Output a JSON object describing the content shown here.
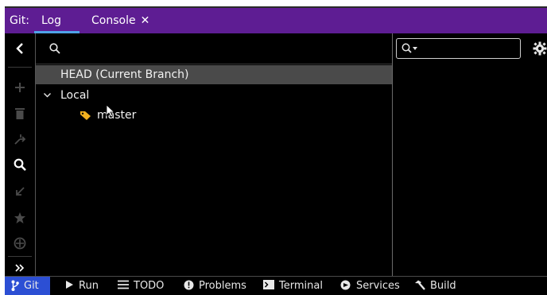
{
  "tabbar": {
    "git_label": "Git:",
    "tabs": [
      {
        "label": "Log",
        "active": true
      },
      {
        "label": "Console",
        "close": "✕"
      }
    ]
  },
  "log": {
    "search_placeholder": "",
    "tree": {
      "head": "HEAD (Current Branch)",
      "local": "Local",
      "branches": [
        "master"
      ]
    }
  },
  "bottom_tools": [
    {
      "label": "Git",
      "icon": "git-branch-icon"
    },
    {
      "label": "Run",
      "icon": "play-icon"
    },
    {
      "label": "TODO",
      "icon": "list-icon"
    },
    {
      "label": "Problems",
      "icon": "warning-icon"
    },
    {
      "label": "Terminal",
      "icon": "terminal-icon"
    },
    {
      "label": "Services",
      "icon": "services-icon"
    },
    {
      "label": "Build",
      "icon": "hammer-icon"
    }
  ],
  "colors": {
    "tabbar_bg": "#5e1d93",
    "active_tab_underline": "#4fa3e8",
    "selected_row_bg": "#4a4a4a",
    "tag_icon": "#f2b01e",
    "active_tool_bg": "#2c4fd4"
  }
}
